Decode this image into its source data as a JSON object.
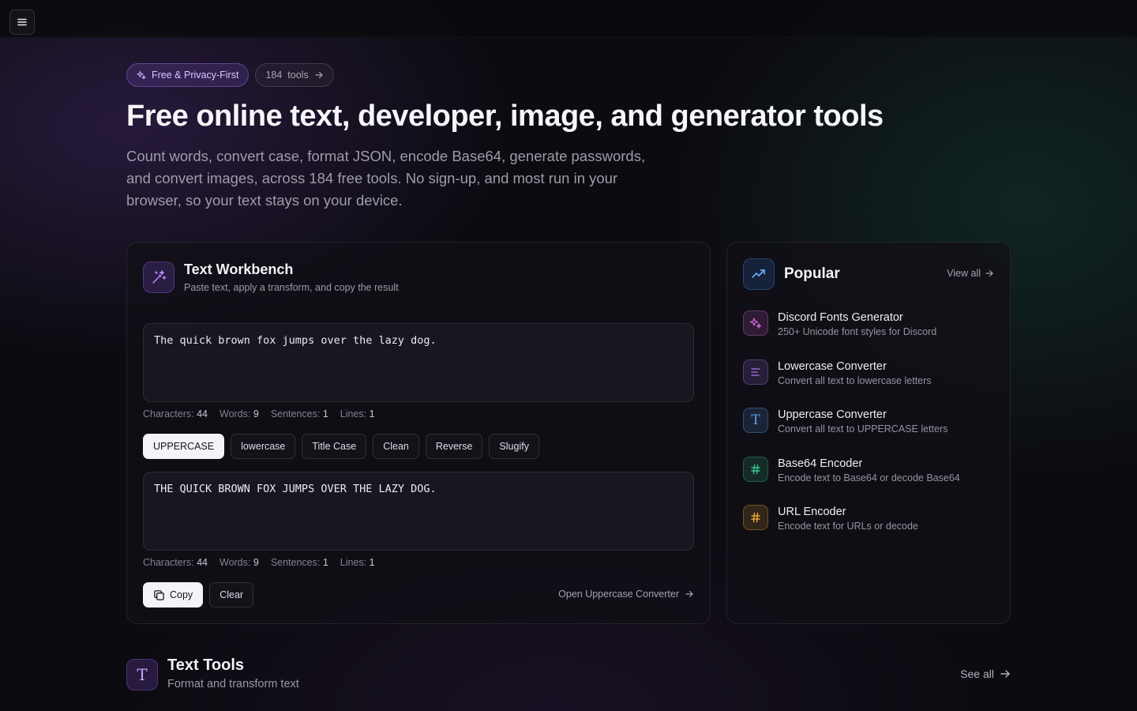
{
  "badges": {
    "privacy": "Free & Privacy-First",
    "tools_count": "184",
    "tools_label": "tools"
  },
  "hero": {
    "title": "Free online text, developer, image, and generator tools",
    "subtitle": "Count words, convert case, format JSON, encode Base64, generate passwords, and convert images, across 184 free tools. No sign-up, and most run in your browser, so your text stays on your device."
  },
  "workbench": {
    "title": "Text Workbench",
    "subtitle": "Paste text, apply a transform, and copy the result",
    "input_text": "The quick brown fox jumps over the lazy dog.",
    "output_text": "THE QUICK BROWN FOX JUMPS OVER THE LAZY DOG.",
    "input_stats": {
      "characters_label": "Characters:",
      "characters": "44",
      "words_label": "Words:",
      "words": "9",
      "sentences_label": "Sentences:",
      "sentences": "1",
      "lines_label": "Lines:",
      "lines": "1"
    },
    "output_stats": {
      "characters_label": "Characters:",
      "characters": "44",
      "words_label": "Words:",
      "words": "9",
      "sentences_label": "Sentences:",
      "sentences": "1",
      "lines_label": "Lines:",
      "lines": "1"
    },
    "transforms": [
      "UPPERCASE",
      "lowercase",
      "Title Case",
      "Clean",
      "Reverse",
      "Slugify"
    ],
    "active_transform": "UPPERCASE",
    "copy_label": "Copy",
    "clear_label": "Clear",
    "open_link": "Open Uppercase Converter"
  },
  "popular": {
    "title": "Popular",
    "view_all": "View all",
    "items": [
      {
        "name": "Discord Fonts Generator",
        "desc": "250+ Unicode font styles for Discord",
        "icon": "sparkles-icon",
        "color": "#d063d8"
      },
      {
        "name": "Lowercase Converter",
        "desc": "Convert all text to lowercase letters",
        "icon": "lines-icon",
        "color": "#a978f2"
      },
      {
        "name": "Uppercase Converter",
        "desc": "Convert all text to UPPERCASE letters",
        "icon": "type-icon",
        "color": "#5c9ded"
      },
      {
        "name": "Base64 Encoder",
        "desc": "Encode text to Base64 or decode Base64",
        "icon": "hash-icon",
        "color": "#35c48e"
      },
      {
        "name": "URL Encoder",
        "desc": "Encode text for URLs or decode",
        "icon": "hash-icon",
        "color": "#e8a838"
      }
    ]
  },
  "section": {
    "title": "Text Tools",
    "subtitle": "Format and transform text",
    "see_all": "See all"
  }
}
